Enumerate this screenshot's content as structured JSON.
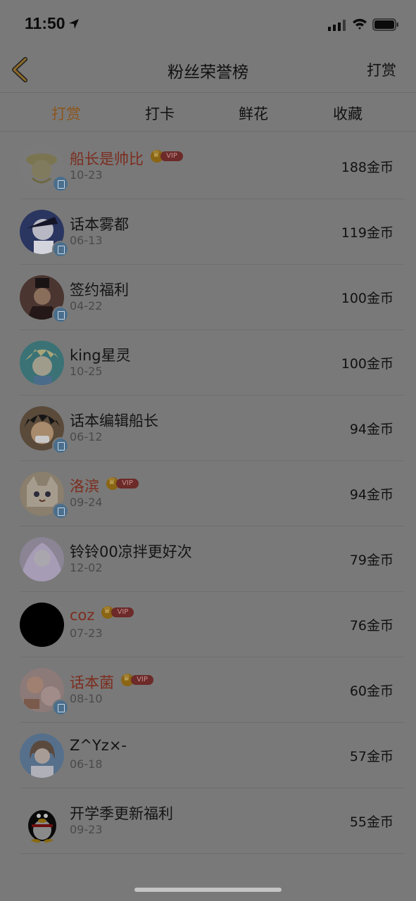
{
  "status_bar": {
    "time": "11:50"
  },
  "nav": {
    "title": "粉丝荣誉榜",
    "right_label": "打赏"
  },
  "tabs": [
    {
      "label": "打赏",
      "active": true
    },
    {
      "label": "打卡",
      "active": false
    },
    {
      "label": "鲜花",
      "active": false
    },
    {
      "label": "收藏",
      "active": false
    }
  ],
  "vip_label": "VIP",
  "list": [
    {
      "name": "船长是帅比",
      "date": "10-23",
      "coins": "188金币",
      "vip": true,
      "badge": true
    },
    {
      "name": "话本雾都",
      "date": "06-13",
      "coins": "119金币",
      "vip": false,
      "badge": true
    },
    {
      "name": "签约福利",
      "date": "04-22",
      "coins": "100金币",
      "vip": false,
      "badge": true
    },
    {
      "name": "king星灵",
      "date": "10-25",
      "coins": "100金币",
      "vip": false,
      "badge": false
    },
    {
      "name": "话本编辑船长",
      "date": "06-12",
      "coins": "94金币",
      "vip": false,
      "badge": true
    },
    {
      "name": "洛滨",
      "date": "09-24",
      "coins": "94金币",
      "vip": true,
      "badge": true
    },
    {
      "name": "铃铃00凉拌更好次",
      "date": "12-02",
      "coins": "79金币",
      "vip": false,
      "badge": false
    },
    {
      "name": "coz",
      "date": "07-23",
      "coins": "76金币",
      "vip": true,
      "badge": false
    },
    {
      "name": "话本菌",
      "date": "08-10",
      "coins": "60金币",
      "vip": true,
      "badge": true
    },
    {
      "name": "Z^Yz×-",
      "date": "06-18",
      "coins": "57金币",
      "vip": false,
      "badge": false
    },
    {
      "name": "开学季更新福利",
      "date": "09-23",
      "coins": "55金币",
      "vip": false,
      "badge": false
    }
  ]
}
